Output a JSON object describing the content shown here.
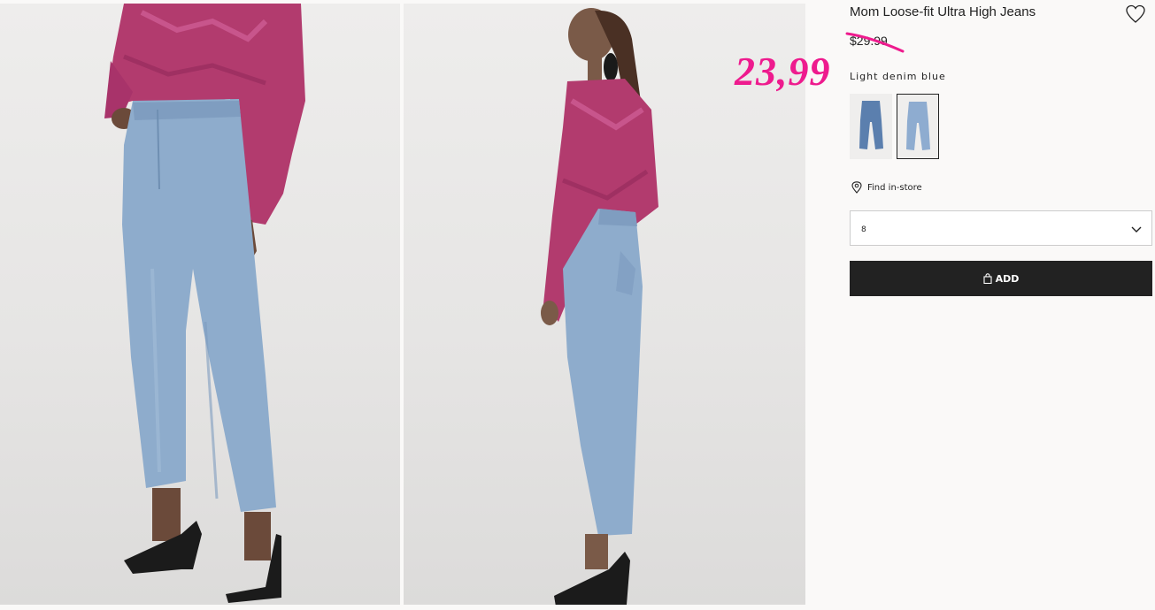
{
  "product": {
    "title": "Mom Loose-fit Ultra High Jeans",
    "old_price": "$29.99",
    "sale_price": "23,99",
    "color_name": "Light denim blue",
    "selected_size": "8",
    "find_in_store": "Find in-store",
    "add_label": "ADD"
  },
  "swatches": [
    {
      "name": "denim-blue",
      "color": "#5b7fae",
      "selected": false
    },
    {
      "name": "light-denim-blue",
      "color": "#8eacd0",
      "selected": true
    }
  ],
  "icons": {
    "favorite": "heart-icon",
    "location": "location-pin-icon",
    "dropdown": "chevron-down-icon",
    "bag": "shopping-bag-icon"
  },
  "colors": {
    "sale_accent": "#ee1b8e",
    "button_bg": "#222222",
    "denim": "#8eaccc",
    "top": "#b23b6e"
  }
}
